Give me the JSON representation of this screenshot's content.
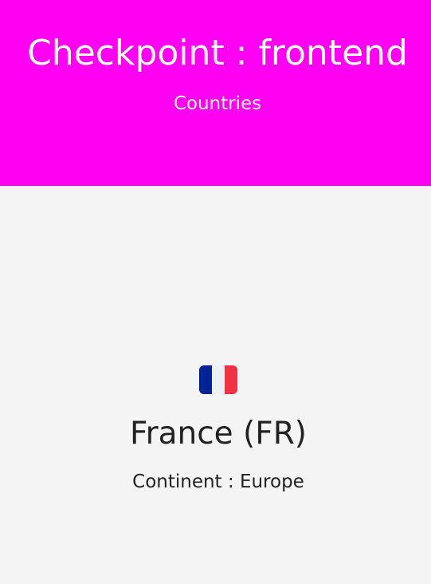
{
  "header": {
    "title": "Checkpoint : frontend",
    "subtitle": "Countries"
  },
  "country": {
    "flag_icon": "france-flag-icon",
    "flag_colors": [
      "#002395",
      "#edf0f5",
      "#ef3340"
    ],
    "name": "France (FR)",
    "continent": "Continent : Europe"
  },
  "colors": {
    "header_background": "#ff00f3",
    "page_background": "#f4f4f4",
    "text": "#222222"
  }
}
